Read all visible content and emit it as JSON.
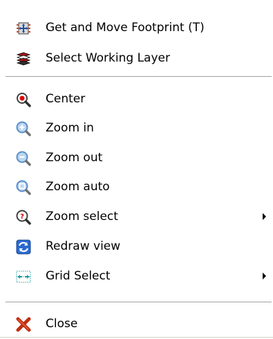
{
  "menu": {
    "items": [
      {
        "label": "Get and Move Footprint (T)",
        "icon": "footprint-move-icon"
      },
      {
        "label": "Select Working Layer",
        "icon": "layers-icon"
      },
      {
        "label": "Center",
        "icon": "center-magnifier-icon"
      },
      {
        "label": "Zoom in",
        "icon": "zoom-in-icon"
      },
      {
        "label": "Zoom out",
        "icon": "zoom-out-icon"
      },
      {
        "label": "Zoom auto",
        "icon": "zoom-auto-icon"
      },
      {
        "label": "Zoom select",
        "icon": "zoom-select-icon",
        "submenu": true
      },
      {
        "label": "Redraw view",
        "icon": "redraw-icon"
      },
      {
        "label": "Grid Select",
        "icon": "grid-icon",
        "submenu": true
      },
      {
        "label": "Close",
        "icon": "close-icon"
      }
    ]
  },
  "colors": {
    "separator": "#a0a0a0",
    "close_red": "#c03010",
    "magnifier_blue": "#5a8fc8",
    "center_red": "#e00000",
    "redraw_blue": "#2a6ad0",
    "grid_teal": "#1a9aa0"
  }
}
